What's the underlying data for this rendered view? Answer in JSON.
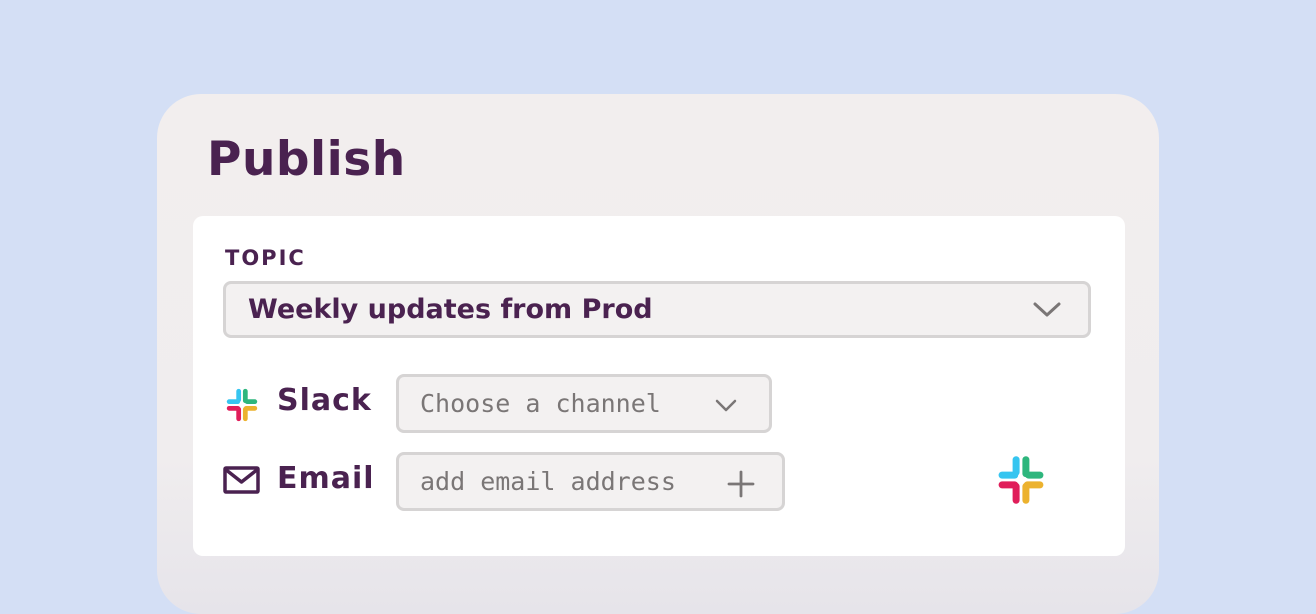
{
  "panel": {
    "title": "Publish"
  },
  "topic": {
    "label": "TOPIC",
    "selected": "Weekly updates from Prod"
  },
  "slack": {
    "label": "Slack",
    "channel_placeholder": "Choose a channel"
  },
  "email": {
    "label": "Email",
    "input_placeholder": "add email address"
  },
  "icons": {
    "slack_logo": "slack-logo-icon",
    "mail": "mail-icon",
    "chevron": "chevron-down-icon",
    "plus": "plus-icon"
  },
  "colors": {
    "background": "#d4dff5",
    "panel": "#f2eeee",
    "text_primary": "#4a2250",
    "placeholder": "#7a7676",
    "field_border": "#d6d4d4",
    "slack_blue": "#36c5f0",
    "slack_green": "#2eb67d",
    "slack_red": "#e01e5a",
    "slack_yellow": "#ecb22e"
  }
}
